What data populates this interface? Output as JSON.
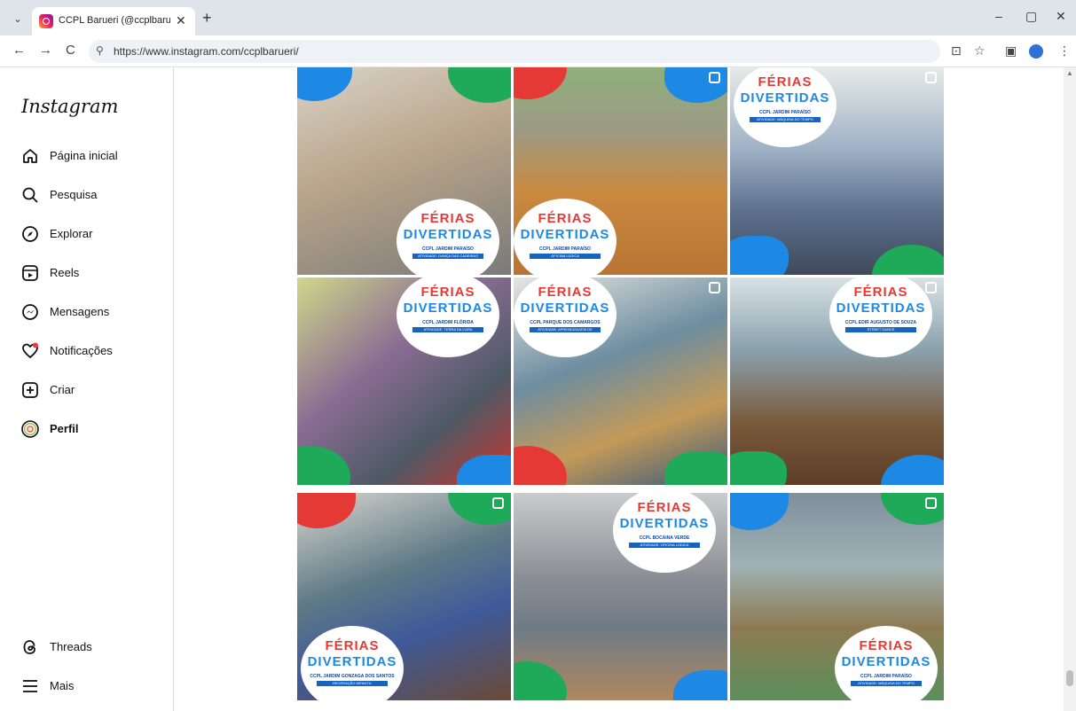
{
  "browser": {
    "tab_title": "CCPL Barueri (@ccplbarueri) • I",
    "tab_close": "✕",
    "new_tab": "+",
    "url": "https://www.instagram.com/ccplbarueri/",
    "window_minimize": "–",
    "window_maximize": "▢",
    "window_close": "✕",
    "back": "←",
    "forward": "→",
    "reload": "C",
    "site_info": "⚲",
    "install": "⊡",
    "bookmark": "☆",
    "sidepanel": "▣",
    "menu": "⋮",
    "tab_search": "⌄"
  },
  "sidebar": {
    "logo": "Instagram",
    "items": [
      {
        "label": "Página inicial",
        "icon": "home-icon"
      },
      {
        "label": "Pesquisa",
        "icon": "search-icon"
      },
      {
        "label": "Explorar",
        "icon": "compass-icon"
      },
      {
        "label": "Reels",
        "icon": "reels-icon"
      },
      {
        "label": "Mensagens",
        "icon": "messenger-icon"
      },
      {
        "label": "Notificações",
        "icon": "heart-icon"
      },
      {
        "label": "Criar",
        "icon": "plus-square-icon"
      },
      {
        "label": "Perfil",
        "icon": "profile-avatar"
      },
      {
        "label": "Threads",
        "icon": "threads-icon"
      },
      {
        "label": "Mais",
        "icon": "menu-icon"
      }
    ]
  },
  "posts": [
    {
      "title1": "FÉRIAS",
      "title2": "DIVERTIDAS",
      "unit": "CCPL JARDIM PARAÍSO",
      "activity": "ATIVIDADE: DANÇA DAS CADEIRAS",
      "photo": "#b9a58a"
    },
    {
      "title1": "FÉRIAS",
      "title2": "DIVERTIDAS",
      "unit": "CCPL JARDIM PARAÍSO",
      "activity": "OFICINA LÚDICA",
      "photo": "#c98a3f"
    },
    {
      "title1": "FÉRIAS",
      "title2": "DIVERTIDAS",
      "unit": "CCPL JARDIM PARAÍSO",
      "activity": "ATIVIDADE: MÁQUINA DO TEMPO",
      "photo": "#5b6f8c"
    },
    {
      "title1": "FÉRIAS",
      "title2": "DIVERTIDAS",
      "unit": "CCPL JARDIM FLÓRIDA",
      "activity": "ATIVIDADE: TERRA DA CARA",
      "photo": "#8a6c93"
    },
    {
      "title1": "FÉRIAS",
      "title2": "DIVERTIDAS",
      "unit": "CCPL PARQUE DOS CAMARGOS",
      "activity": "ATIVIDADE: APRENDIZAGEM DE ATITUDES",
      "photo": "#6d8da0"
    },
    {
      "title1": "FÉRIAS",
      "title2": "DIVERTIDAS",
      "unit": "CCPL EDIR AUGUSTO DE SOUZA",
      "activity": "STREET DANCE",
      "photo": "#7a5a3c"
    },
    {
      "title1": "FÉRIAS",
      "title2": "DIVERTIDAS",
      "unit": "CCPL JARDIM GONZAGA DOS SANTOS",
      "activity": "RECREAÇÃO INFANTIL",
      "photo": "#5f7a86"
    },
    {
      "title1": "FÉRIAS",
      "title2": "DIVERTIDAS",
      "unit": "CCPL BOCAINA VERDE",
      "activity": "ATIVIDADE: OFICINA LÚDICA",
      "photo": "#8c8f95"
    },
    {
      "title1": "FÉRIAS",
      "title2": "DIVERTIDAS",
      "unit": "CCPL JARDIM PARAÍSO",
      "activity": "ATIVIDADE: MÁQUINA DO TEMPO",
      "photo": "#8e7a52"
    }
  ],
  "colors": {
    "red": "#e53935",
    "blue": "#1e88e5",
    "green": "#1faa59",
    "navy": "#1565c0"
  }
}
